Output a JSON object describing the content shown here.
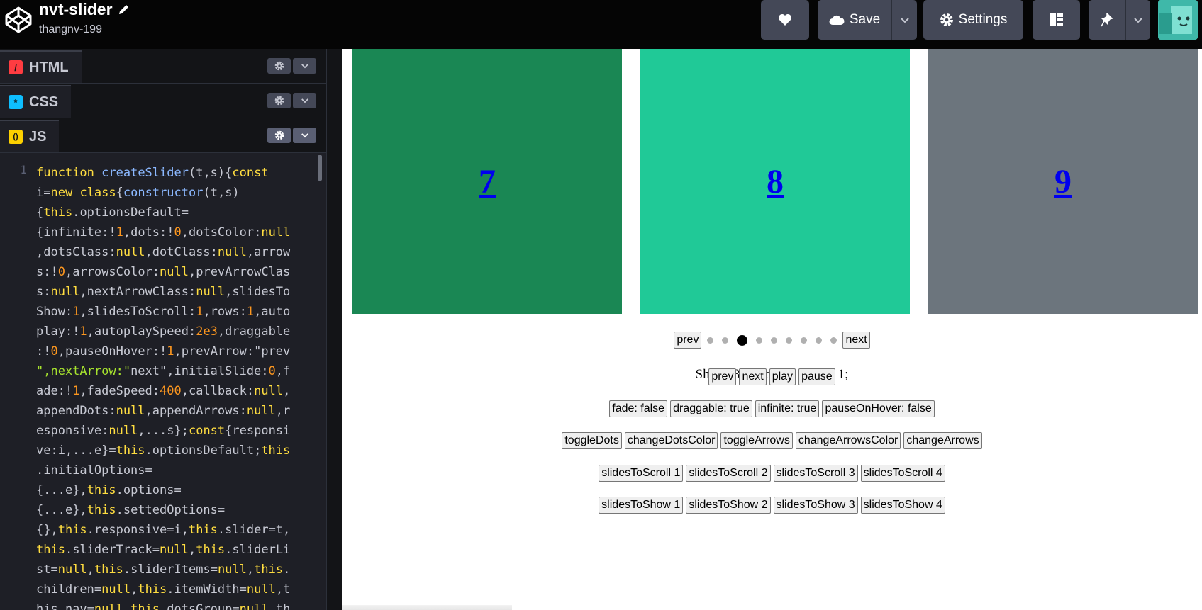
{
  "header": {
    "title": "nvt-slider",
    "user": "thangnv-199",
    "save_label": "Save",
    "settings_label": "Settings"
  },
  "editor": {
    "tabs": [
      {
        "label": "HTML",
        "icon": "html-icon",
        "color": "#ff3c41",
        "glyph": "/"
      },
      {
        "label": "CSS",
        "icon": "css-icon",
        "color": "#0ebeff",
        "glyph": "*"
      },
      {
        "label": "JS",
        "icon": "js-icon",
        "color": "#fcd000",
        "glyph": "()"
      }
    ],
    "line_number": "1",
    "code_lines": [
      "function createSlider(t,s){const",
      "i=new class{constructor(t,s)",
      "{this.optionsDefault=",
      "{infinite:!1,dots:!0,dotsColor:null",
      ",dotsClass:null,dotClass:null,arrow",
      "s:!0,arrowsColor:null,prevArrowClas",
      "s:null,nextArrowClass:null,slidesTo",
      "Show:1,slidesToScroll:1,rows:1,auto",
      "play:!1,autoplaySpeed:2e3,draggable",
      ":!0,pauseOnHover:!1,prevArrow:\"prev",
      "\",nextArrow:\"next\",initialSlide:0,f",
      "ade:!1,fadeSpeed:400,callback:null,",
      "appendDots:null,appendArrows:null,r",
      "esponsive:null,...s};const{responsi",
      "ve:i,...e}=this.optionsDefault;this",
      ".initialOptions=",
      "{...e},this.options=",
      "{...e},this.settedOptions=",
      "{},this.responsive=i,this.slider=t,",
      "this.sliderTrack=null,this.sliderLi",
      "st=null,this.sliderItems=null,this.",
      "children=null,this.itemWidth=null,t",
      "his.nav=null,this.dotsGroup=null,th"
    ]
  },
  "preview": {
    "slides": [
      {
        "label": "7",
        "color": "#1a8754"
      },
      {
        "label": "8",
        "color": "#20c997"
      },
      {
        "label": "9",
        "color": "#6c757d"
      }
    ],
    "nav": {
      "prev": "prev",
      "next": "next",
      "dots_count": 9,
      "active_dot": 2
    },
    "status": "Show: 3; Scroll: 3; Rows: 1;",
    "button_rows": [
      [
        "prev",
        "next",
        "play",
        "pause"
      ],
      [
        "fade: false",
        "draggable: true",
        "infinite: true",
        "pauseOnHover: false"
      ],
      [
        "toggleDots",
        "changeDotsColor",
        "toggleArrows",
        "changeArrowsColor",
        "changeArrows"
      ],
      [
        "slidesToScroll 1",
        "slidesToScroll 2",
        "slidesToScroll 3",
        "slidesToScroll 4"
      ],
      [
        "slidesToShow 1",
        "slidesToShow 2",
        "slidesToShow 3",
        "slidesToShow 4"
      ]
    ]
  },
  "colors": {
    "header_bg": "#050505",
    "button_bg": "#444857",
    "editor_bg": "#1e1f26"
  }
}
